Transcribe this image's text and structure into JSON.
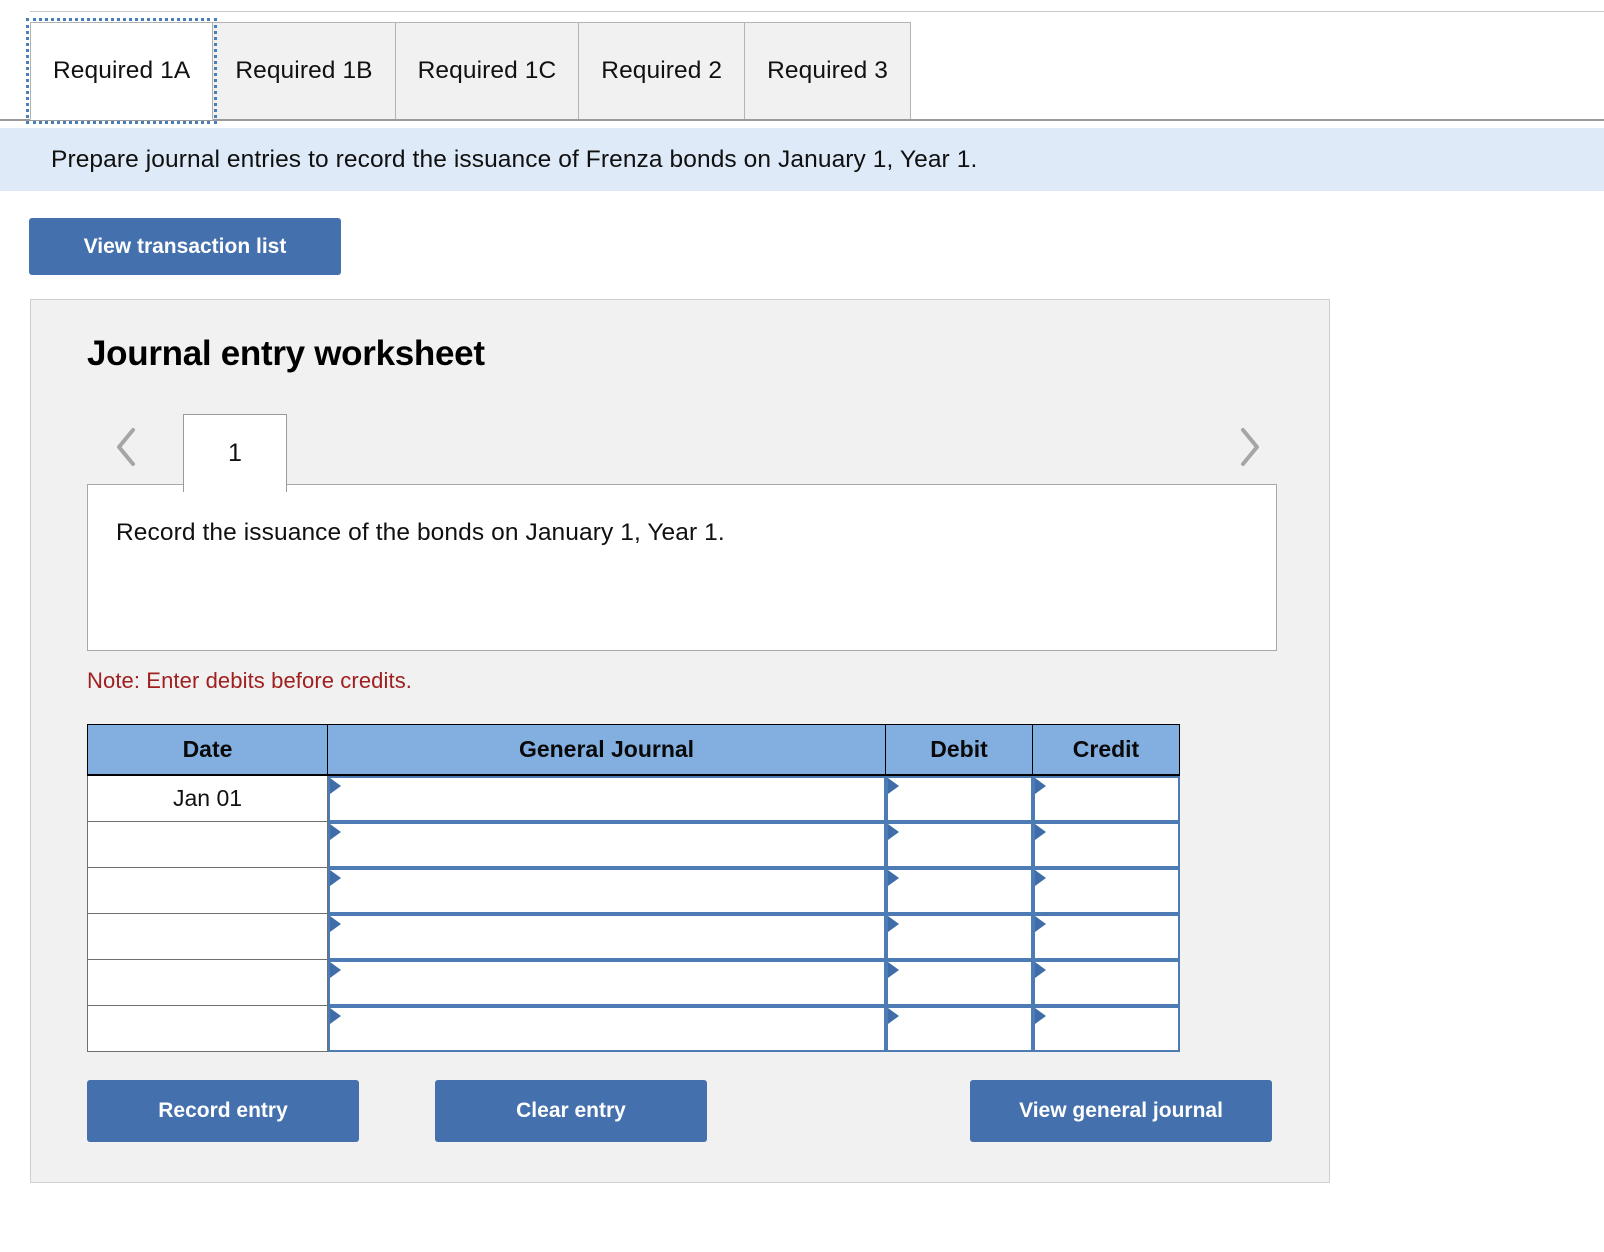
{
  "tabs": [
    {
      "label": "Required 1A",
      "active": true
    },
    {
      "label": "Required 1B",
      "active": false
    },
    {
      "label": "Required 1C",
      "active": false
    },
    {
      "label": "Required 2",
      "active": false
    },
    {
      "label": "Required 3",
      "active": false
    }
  ],
  "banner": {
    "text": "Prepare journal entries to record the issuance of Frenza bonds on January 1, Year 1."
  },
  "toolbar": {
    "view_transaction_list_label": "View transaction list"
  },
  "worksheet": {
    "title": "Journal entry worksheet",
    "pager": {
      "prev_icon": "chevron-left-icon",
      "next_icon": "chevron-right-icon",
      "current_page": "1"
    },
    "description": "Record the issuance of the bonds on January 1, Year 1.",
    "note": "Note: Enter debits before credits.",
    "table": {
      "headers": [
        "Date",
        "General Journal",
        "Debit",
        "Credit"
      ],
      "rows": [
        {
          "date": "Jan 01",
          "general_journal": "",
          "debit": "",
          "credit": ""
        },
        {
          "date": "",
          "general_journal": "",
          "debit": "",
          "credit": ""
        },
        {
          "date": "",
          "general_journal": "",
          "debit": "",
          "credit": ""
        },
        {
          "date": "",
          "general_journal": "",
          "debit": "",
          "credit": ""
        },
        {
          "date": "",
          "general_journal": "",
          "debit": "",
          "credit": ""
        },
        {
          "date": "",
          "general_journal": "",
          "debit": "",
          "credit": ""
        }
      ]
    },
    "actions": {
      "record_entry_label": "Record entry",
      "clear_entry_label": "Clear entry",
      "view_general_journal_label": "View general journal"
    }
  },
  "colors": {
    "accent_blue": "#4470ad",
    "header_blue": "#82aee0",
    "banner_blue": "#deeaf7",
    "panel_gray": "#f1f1f1",
    "note_red": "#a02020",
    "cell_border_blue": "#4d7cb5"
  }
}
